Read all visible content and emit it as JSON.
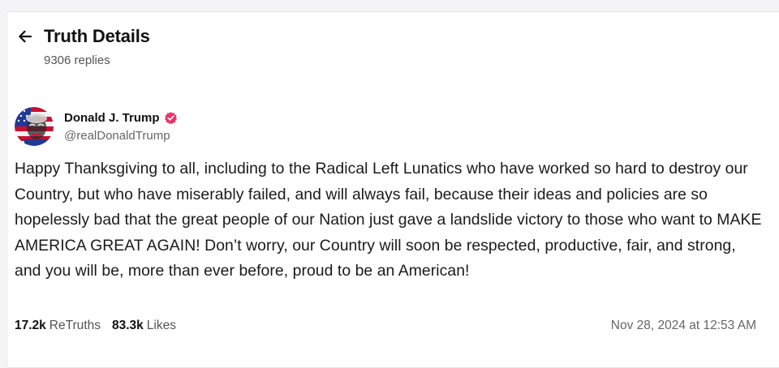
{
  "header": {
    "title": "Truth Details",
    "replies": "9306 replies",
    "back_icon": "arrow-left-icon"
  },
  "author": {
    "display_name": "Donald J. Trump",
    "handle": "@realDonaldTrump",
    "verified_icon": "verified-badge-icon",
    "verified_color": "#e8366b"
  },
  "post": {
    "text": "Happy Thanksgiving to all, including to the Radical Left Lunatics who have worked so hard to destroy our Country, but who have miserably failed, and will always fail, because their ideas and policies are so hopelessly bad that the great people of our Nation just gave a landslide victory to those who want to MAKE AMERICA GREAT AGAIN! Don’t worry, our Country will soon be respected, productive, fair, and strong, and you will be, more than ever before, proud to be an American!",
    "retruths_count": "17.2k",
    "retruths_label": "ReTruths",
    "likes_count": "83.3k",
    "likes_label": "Likes",
    "timestamp": "Nov 28, 2024 at 12:53 AM"
  }
}
